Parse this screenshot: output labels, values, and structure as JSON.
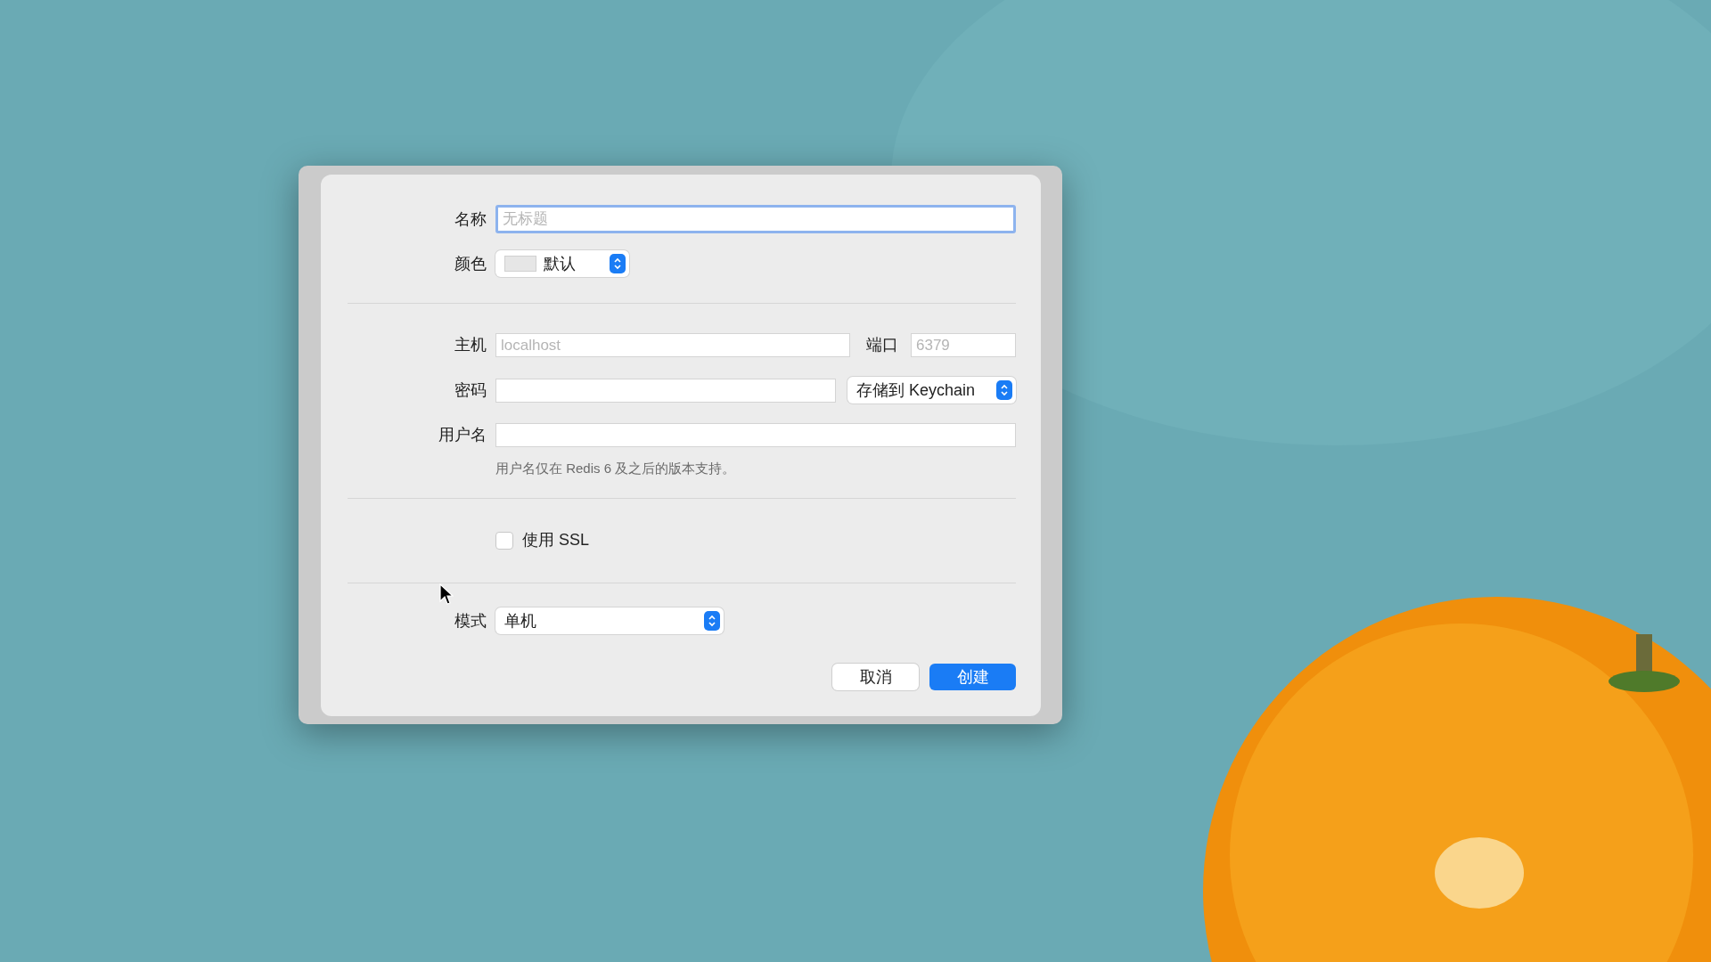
{
  "dialog": {
    "name": {
      "label": "名称",
      "placeholder": "无标题",
      "focused": true
    },
    "color": {
      "label": "颜色",
      "value": "默认"
    },
    "host": {
      "label": "主机",
      "placeholder": "localhost"
    },
    "port": {
      "label": "端口",
      "placeholder": "6379"
    },
    "password": {
      "label": "密码",
      "store": "存储到 Keychain"
    },
    "username": {
      "label": "用户名",
      "hint": "用户名仅在 Redis 6 及之后的版本支持。"
    },
    "ssl": {
      "label": "使用 SSL",
      "checked": false
    },
    "mode": {
      "label": "模式",
      "value": "单机"
    },
    "buttons": [
      {
        "label": "取消",
        "kind": "secondary"
      },
      {
        "label": "创建",
        "kind": "primary"
      }
    ]
  }
}
